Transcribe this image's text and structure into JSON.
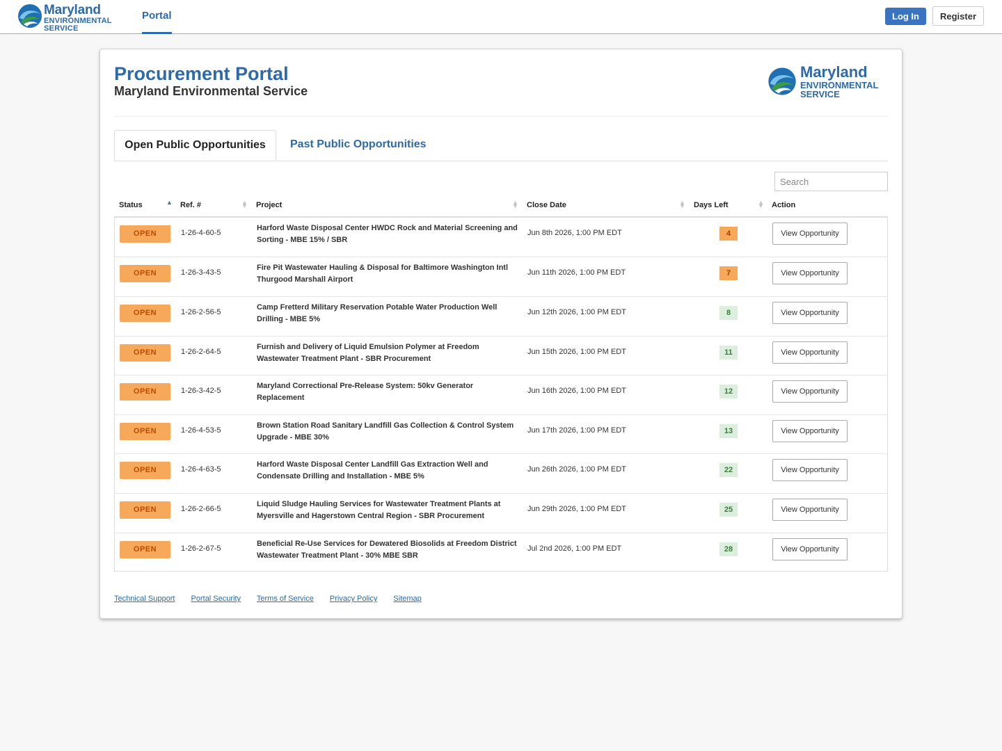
{
  "brand": {
    "line1": "Maryland",
    "line2": "ENVIRONMENTAL",
    "line3": "SERVICE"
  },
  "nav": {
    "portal": "Portal",
    "login": "Log In",
    "register": "Register"
  },
  "header": {
    "title": "Procurement Portal",
    "subtitle": "Maryland Environmental Service"
  },
  "tabs": {
    "open": "Open Public Opportunities",
    "past": "Past Public Opportunities"
  },
  "search": {
    "placeholder": "Search"
  },
  "columns": {
    "status": "Status",
    "ref": "Ref. #",
    "project": "Project",
    "close": "Close Date",
    "days": "Days Left",
    "action": "Action"
  },
  "rows": [
    {
      "status": "OPEN",
      "ref": "1-26-4-60-5",
      "project": "Harford Waste Disposal Center HWDC Rock and Material Screening and Sorting - MBE 15% / SBR",
      "close": "Jun 8th 2026, 1:00 PM EDT",
      "days": "4",
      "urgency": "warn",
      "action": "View Opportunity"
    },
    {
      "status": "OPEN",
      "ref": "1-26-3-43-5",
      "project": "Fire Pit Wastewater Hauling & Disposal for Baltimore Washington Intl Thurgood Marshall Airport",
      "close": "Jun 11th 2026, 1:00 PM EDT",
      "days": "7",
      "urgency": "warn",
      "action": "View Opportunity"
    },
    {
      "status": "OPEN",
      "ref": "1-26-2-56-5",
      "project": "Camp Fretterd Military Reservation Potable Water Production Well Drilling - MBE 5%",
      "close": "Jun 12th 2026, 1:00 PM EDT",
      "days": "8",
      "urgency": "ok",
      "action": "View Opportunity"
    },
    {
      "status": "OPEN",
      "ref": "1-26-2-64-5",
      "project": "Furnish and Delivery of Liquid Emulsion Polymer at Freedom Wastewater Treatment Plant - SBR Procurement",
      "close": "Jun 15th 2026, 1:00 PM EDT",
      "days": "11",
      "urgency": "ok",
      "action": "View Opportunity"
    },
    {
      "status": "OPEN",
      "ref": "1-26-3-42-5",
      "project": "Maryland Correctional Pre-Release System: 50kv Generator Replacement",
      "close": "Jun 16th 2026, 1:00 PM EDT",
      "days": "12",
      "urgency": "ok",
      "action": "View Opportunity"
    },
    {
      "status": "OPEN",
      "ref": "1-26-4-53-5",
      "project": "Brown Station Road Sanitary Landfill Gas Collection & Control System Upgrade - MBE 30%",
      "close": "Jun 17th 2026, 1:00 PM EDT",
      "days": "13",
      "urgency": "ok",
      "action": "View Opportunity"
    },
    {
      "status": "OPEN",
      "ref": "1-26-4-63-5",
      "project": "Harford Waste Disposal Center Landfill Gas Extraction Well and Condensate Drilling and Installation - MBE 5%",
      "close": "Jun 26th 2026, 1:00 PM EDT",
      "days": "22",
      "urgency": "ok",
      "action": "View Opportunity"
    },
    {
      "status": "OPEN",
      "ref": "1-26-2-66-5",
      "project": "Liquid Sludge Hauling Services for Wastewater Treatment Plants at Myersville and Hagerstown Central Region - SBR Procurement",
      "close": "Jun 29th 2026, 1:00 PM EDT",
      "days": "25",
      "urgency": "ok",
      "action": "View Opportunity"
    },
    {
      "status": "OPEN",
      "ref": "1-26-2-67-5",
      "project": "Beneficial Re-Use Services for Dewatered Biosolids at Freedom District Wastewater Treatment Plant - 30% MBE SBR",
      "close": "Jul 2nd 2026, 1:00 PM EDT",
      "days": "28",
      "urgency": "ok",
      "action": "View Opportunity"
    }
  ],
  "footer": {
    "links": [
      "Technical Support",
      "Portal Security",
      "Terms of Service",
      "Privacy Policy",
      "Sitemap"
    ]
  }
}
